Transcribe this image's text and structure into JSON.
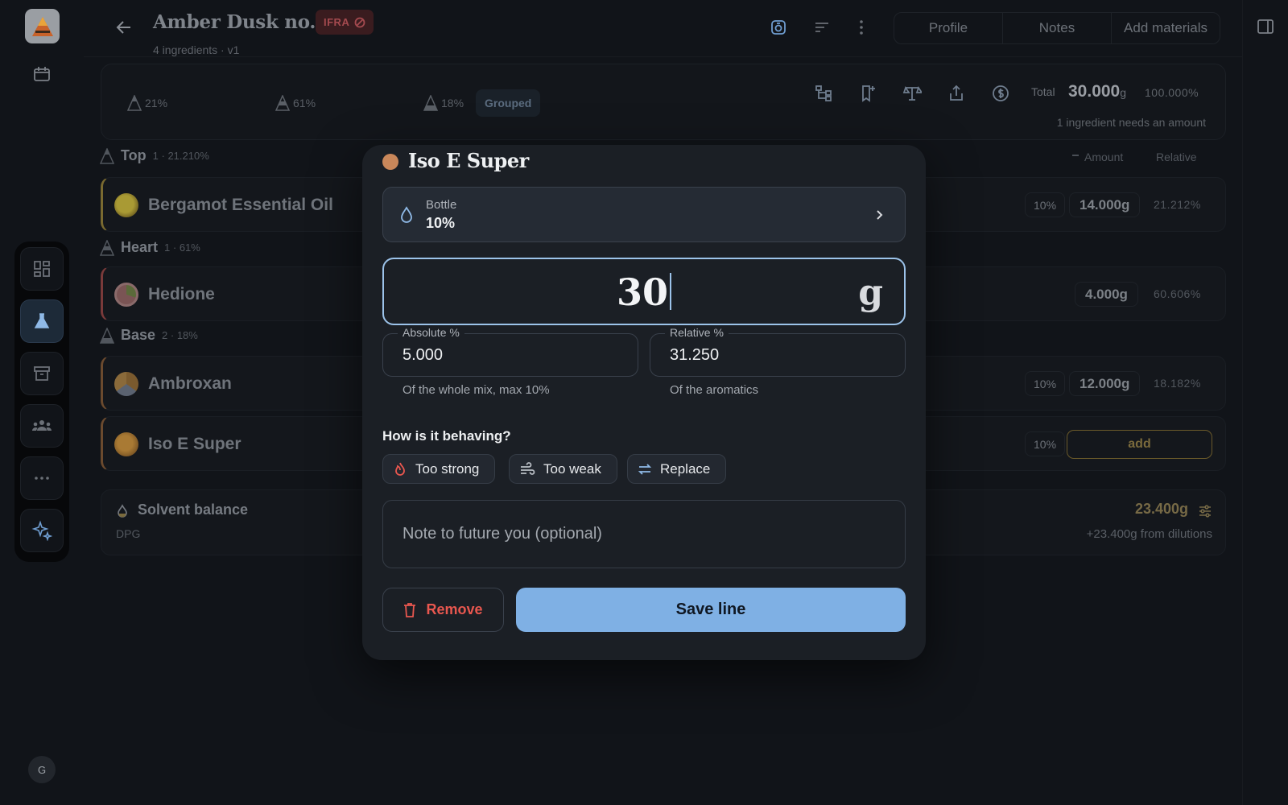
{
  "header": {
    "title": "Amber Dusk no. 1",
    "badge": "IFRA",
    "subtitle": "4 ingredients · v1",
    "tabs": [
      "Profile",
      "Notes",
      "Add materials"
    ]
  },
  "summary": {
    "note_stats": [
      "21%",
      "61%",
      "18%"
    ],
    "grouped_label": "Grouped",
    "total_label": "Total",
    "total_value": "30.000",
    "total_unit": "g",
    "total_pct": "100.000%",
    "needs_amount": "1 ingredient needs an amount"
  },
  "columns": {
    "amount": "Amount",
    "relative": "Relative"
  },
  "groups": [
    {
      "name": "Top",
      "meta": "1 · 21.210%"
    },
    {
      "name": "Heart",
      "meta": "1 · 61%"
    },
    {
      "name": "Base",
      "meta": "2 · 18%"
    }
  ],
  "rows": [
    {
      "name": "Bergamot Essential Oil",
      "dilution": "10%",
      "amount": "14.000g",
      "relative": "21.212%"
    },
    {
      "name": "Hedione",
      "dilution": "",
      "amount": "4.000g",
      "relative": "60.606%"
    },
    {
      "name": "Ambroxan",
      "dilution": "10%",
      "amount": "12.000g",
      "relative": "18.182%"
    },
    {
      "name": "Iso E Super",
      "dilution": "10%",
      "add_label": "add"
    }
  ],
  "solvent": {
    "label": "Solvent balance",
    "sub": "DPG",
    "value": "23.400g",
    "note": "+23.400g from dilutions"
  },
  "rail": {
    "avatar": "G"
  },
  "modal": {
    "title": "Iso E Super",
    "bottle_label": "Bottle",
    "bottle_value": "10%",
    "amount_value": "30",
    "amount_unit": "g",
    "absolute_label": "Absolute %",
    "absolute_value": "5.000",
    "absolute_help": "Of the whole mix, max 10%",
    "relative_label": "Relative %",
    "relative_value": "31.250",
    "relative_help": "Of the aromatics",
    "question": "How is it behaving?",
    "behaviors": [
      "Too strong",
      "Too weak",
      "Replace"
    ],
    "note_placeholder": "Note to future you (optional)",
    "remove_label": "Remove",
    "save_label": "Save line"
  },
  "colors": {
    "accent": "#7fb0e4",
    "danger": "#e9574f",
    "ingredient_dot": "#c9875a",
    "background": "#111419",
    "modal_bg": "#1b1f25"
  }
}
